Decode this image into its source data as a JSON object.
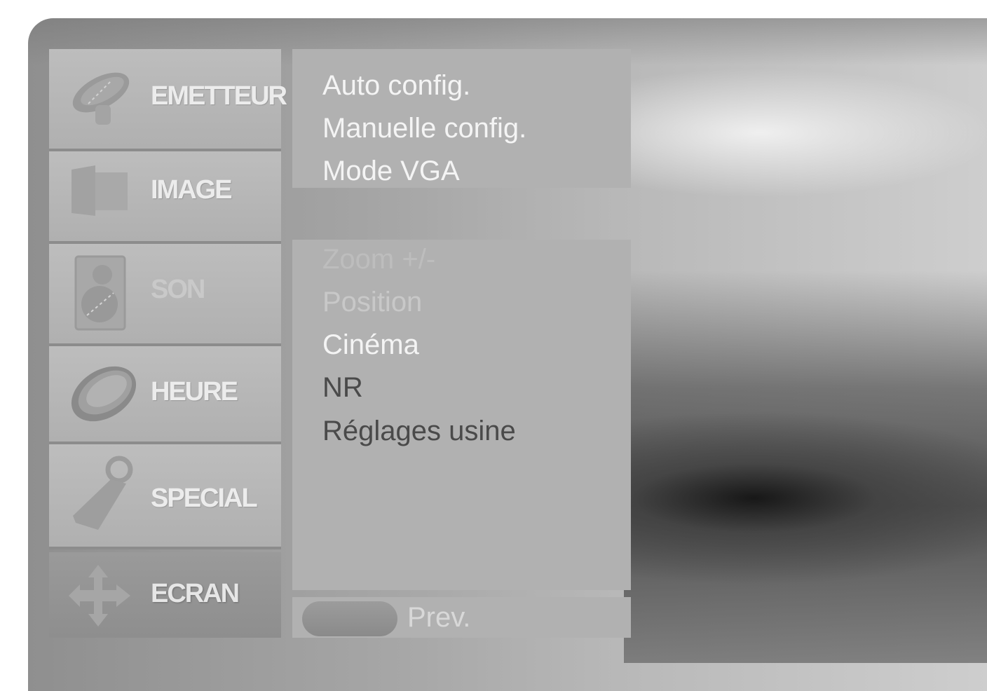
{
  "main_menu": {
    "items": [
      {
        "label": "EMETTEUR",
        "icon": "satellite-dish-icon"
      },
      {
        "label": "IMAGE",
        "icon": "screen-icon"
      },
      {
        "label": "SON",
        "icon": "speaker-icon"
      },
      {
        "label": "HEURE",
        "icon": "clock-icon"
      },
      {
        "label": "SPECIAL",
        "icon": "key-icon"
      },
      {
        "label": "ECRAN",
        "icon": "move-arrows-icon"
      }
    ],
    "selected": "ECRAN"
  },
  "submenu": {
    "top_items": [
      "Auto config.",
      "Manuelle config.",
      "Mode VGA"
    ],
    "items": [
      "Zoom +/-",
      "Position",
      "Cinéma",
      "NR",
      "Réglages usine"
    ]
  },
  "footer": {
    "prev_label": "Prev."
  },
  "colors": {
    "panel": "#b1b1b1",
    "menu_item": "#b8b8b8",
    "active_item": "#939393",
    "highlight_text": "#f4f4f4",
    "normal_text": "#4a4a4a"
  }
}
